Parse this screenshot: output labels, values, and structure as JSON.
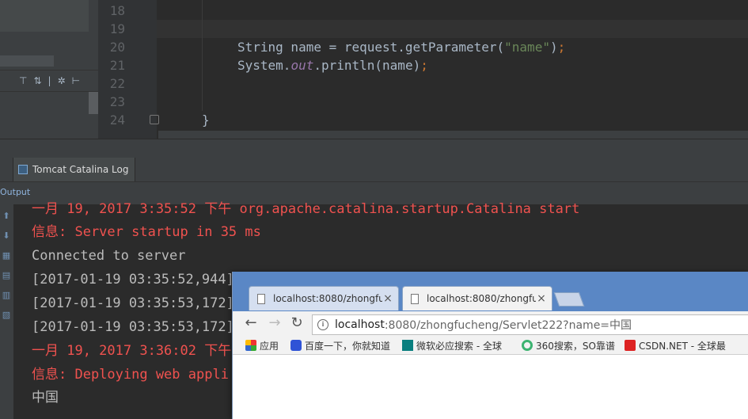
{
  "editor": {
    "line_numbers": [
      "18",
      "19",
      "20",
      "21",
      "22",
      "23",
      "24"
    ],
    "line20": {
      "type": "String",
      "rest": " name = request.getParameter(",
      "arg": "\"name\"",
      "close": ")",
      "semi": ";"
    },
    "line21": {
      "obj": "System.",
      "field": "out",
      "call": ".println(name)",
      "semi": ";"
    },
    "line24": "}",
    "toolbar_icons": [
      "align-top-icon",
      "collapse-icon",
      "settings-icon",
      "pin-icon"
    ]
  },
  "tool_window": {
    "tab_label": "Tomcat Catalina Log",
    "output_label": "Output"
  },
  "console": {
    "lines": [
      {
        "text": "一月 19, 2017 3:35:52 下午 org.apache.catalina.startup.Catalina start",
        "color": "red"
      },
      {
        "text": "信息: Server startup in 35 ms",
        "color": "red"
      },
      {
        "text": "Connected to server",
        "color": "grey"
      },
      {
        "text": "[2017-01-19 03:35:52,944]",
        "color": "grey"
      },
      {
        "text": "[2017-01-19 03:35:53,172]",
        "color": "grey"
      },
      {
        "text": "[2017-01-19 03:35:53,172]",
        "color": "grey"
      },
      {
        "text": "一月 19, 2017 3:36:02 下午",
        "color": "red"
      },
      {
        "text": "信息: Deploying web appli",
        "color": "red"
      },
      {
        "text": "中国",
        "color": "grey"
      }
    ]
  },
  "browser": {
    "tabs": [
      {
        "title": "localhost:8080/zhongfu",
        "close": "×"
      },
      {
        "title": "localhost:8080/zhongfu",
        "close": "×"
      }
    ],
    "url_host": "localhost",
    "url_rest": ":8080/zhongfucheng/Servlet222?name=中国",
    "bookmarks": [
      {
        "label": "应用",
        "icon": "apps-icon"
      },
      {
        "label": "百度一下，你就知道",
        "icon": "baidu-icon"
      },
      {
        "label": "微软必应搜索 - 全球",
        "icon": "bing-icon"
      },
      {
        "label": "360搜索，SO靠谱",
        "icon": "360-icon"
      },
      {
        "label": "CSDN.NET - 全球最",
        "icon": "csdn-icon"
      }
    ]
  },
  "colors": {
    "console_red": "#f0524f",
    "console_grey": "#bbbbbb",
    "string_green": "#6a8759",
    "keyword_orange": "#cc7832"
  }
}
